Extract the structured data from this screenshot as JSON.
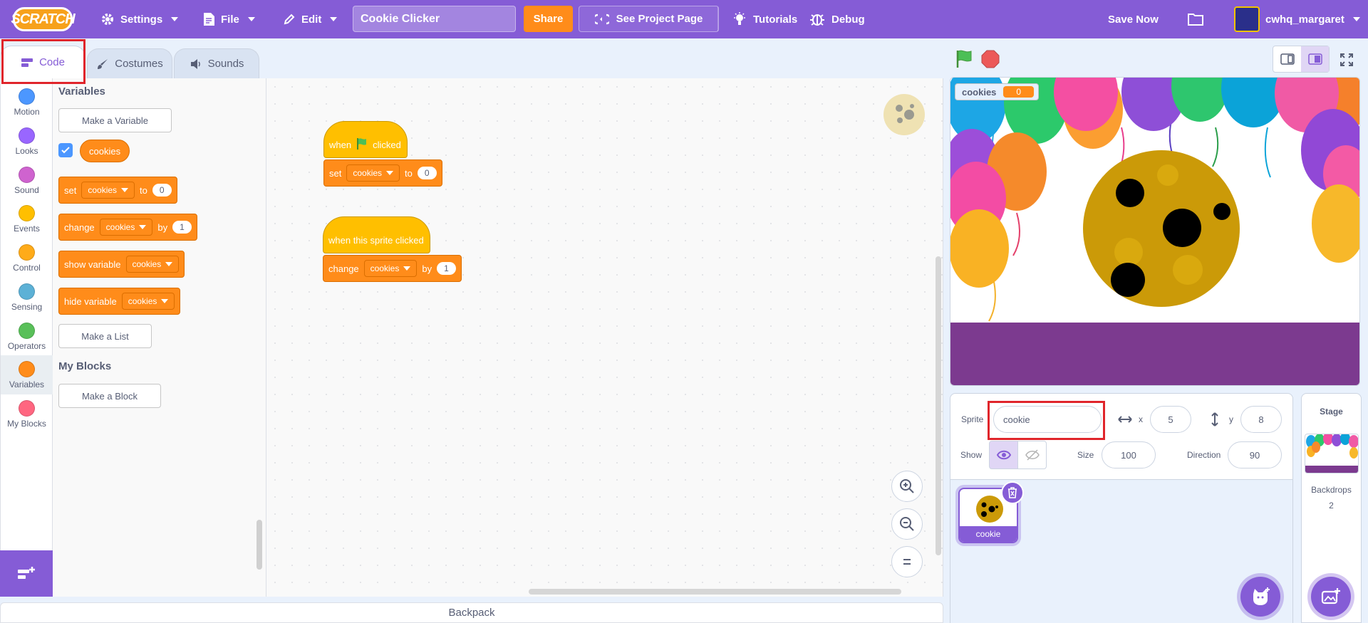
{
  "menubar": {
    "logo": "SCRATCH",
    "settings_label": "Settings",
    "file_label": "File",
    "edit_label": "Edit",
    "project_title": "Cookie Clicker",
    "share_label": "Share",
    "see_project_label": "See Project Page",
    "tutorials_label": "Tutorials",
    "debug_label": "Debug",
    "save_now_label": "Save Now",
    "username": "cwhq_margaret",
    "color": "#855cd6"
  },
  "tabs": {
    "code": "Code",
    "costumes": "Costumes",
    "sounds": "Sounds"
  },
  "categories": [
    {
      "label": "Motion",
      "color": "#4c97ff"
    },
    {
      "label": "Looks",
      "color": "#9966ff"
    },
    {
      "label": "Sound",
      "color": "#cf63cf"
    },
    {
      "label": "Events",
      "color": "#ffbf00"
    },
    {
      "label": "Control",
      "color": "#ffab19"
    },
    {
      "label": "Sensing",
      "color": "#5cb1d6"
    },
    {
      "label": "Operators",
      "color": "#59c059"
    },
    {
      "label": "Variables",
      "color": "#ff8c1a"
    },
    {
      "label": "My Blocks",
      "color": "#ff6680"
    }
  ],
  "palette": {
    "variables_heading": "Variables",
    "make_variable": "Make a Variable",
    "variable_name": "cookies",
    "set_block": {
      "op": "set",
      "var": "cookies",
      "to": "to",
      "value": "0"
    },
    "change_block": {
      "op": "change",
      "var": "cookies",
      "by": "by",
      "value": "1"
    },
    "show_block": {
      "op": "show variable",
      "var": "cookies"
    },
    "hide_block": {
      "op": "hide variable",
      "var": "cookies"
    },
    "make_list": "Make a List",
    "my_blocks_heading": "My Blocks",
    "make_block": "Make a Block"
  },
  "scripts": {
    "script1": {
      "hat_when": "when",
      "hat_clicked": "clicked",
      "op": "set",
      "var": "cookies",
      "to": "to",
      "value": "0"
    },
    "script2": {
      "hat": "when this sprite clicked",
      "op": "change",
      "var": "cookies",
      "by": "by",
      "value": "1"
    }
  },
  "backpack_label": "Backpack",
  "stage": {
    "monitor_label": "cookies",
    "monitor_value": "0"
  },
  "sprite_info": {
    "sprite_label": "Sprite",
    "sprite_name": "cookie",
    "x_label": "x",
    "x_value": "5",
    "y_label": "y",
    "y_value": "8",
    "show_label": "Show",
    "size_label": "Size",
    "size_value": "100",
    "direction_label": "Direction",
    "direction_value": "90"
  },
  "sprite_list": [
    {
      "name": "cookie",
      "selected": true
    }
  ],
  "stage_panel": {
    "title": "Stage",
    "backdrops_label": "Backdrops",
    "backdrops_count": "2"
  }
}
